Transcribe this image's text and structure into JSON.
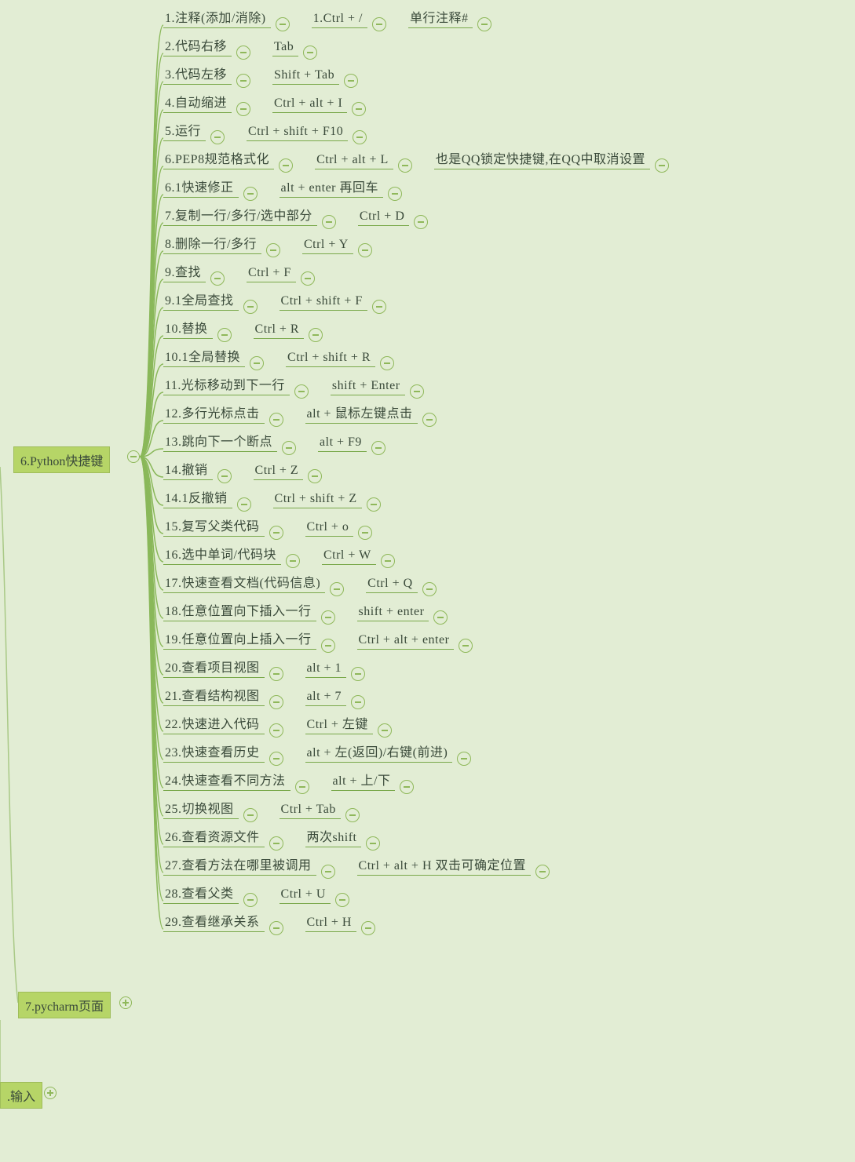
{
  "root": {
    "label": "6.Python快捷键"
  },
  "aux1": {
    "label": "7.pycharm页面"
  },
  "aux2": {
    "label": ".输入"
  },
  "rows": [
    {
      "segs": [
        "1.注释(添加/消除)",
        "1.Ctrl + /",
        "单行注释#"
      ]
    },
    {
      "segs": [
        "2.代码右移",
        "Tab"
      ]
    },
    {
      "segs": [
        "3.代码左移",
        "Shift + Tab"
      ]
    },
    {
      "segs": [
        "4.自动缩进",
        "Ctrl + alt + I"
      ]
    },
    {
      "segs": [
        "5.运行",
        "Ctrl + shift + F10"
      ]
    },
    {
      "segs": [
        "6.PEP8规范格式化",
        "Ctrl + alt + L",
        "也是QQ锁定快捷键,在QQ中取消设置"
      ]
    },
    {
      "segs": [
        "6.1快速修正",
        "alt + enter 再回车"
      ]
    },
    {
      "segs": [
        "7.复制一行/多行/选中部分",
        "Ctrl + D"
      ]
    },
    {
      "segs": [
        "8.删除一行/多行",
        "Ctrl + Y"
      ]
    },
    {
      "segs": [
        "9.查找",
        "Ctrl + F"
      ]
    },
    {
      "segs": [
        "9.1全局查找",
        "Ctrl + shift + F"
      ]
    },
    {
      "segs": [
        "10.替换",
        "Ctrl + R"
      ]
    },
    {
      "segs": [
        "10.1全局替换",
        "Ctrl + shift + R"
      ]
    },
    {
      "segs": [
        "11.光标移动到下一行",
        "shift + Enter"
      ]
    },
    {
      "segs": [
        "12.多行光标点击",
        "alt + 鼠标左键点击"
      ]
    },
    {
      "segs": [
        "13.跳向下一个断点",
        "alt + F9"
      ]
    },
    {
      "segs": [
        "14.撤销",
        "Ctrl + Z"
      ]
    },
    {
      "segs": [
        "14.1反撤销",
        "Ctrl + shift + Z"
      ]
    },
    {
      "segs": [
        "15.复写父类代码",
        "Ctrl + o"
      ]
    },
    {
      "segs": [
        "16.选中单词/代码块",
        "Ctrl + W"
      ]
    },
    {
      "segs": [
        "17.快速查看文档(代码信息)",
        "Ctrl + Q"
      ]
    },
    {
      "segs": [
        "18.任意位置向下插入一行",
        "shift + enter"
      ]
    },
    {
      "segs": [
        "19.任意位置向上插入一行",
        "Ctrl + alt + enter"
      ]
    },
    {
      "segs": [
        "20.查看项目视图",
        "alt + 1"
      ]
    },
    {
      "segs": [
        "21.查看结构视图",
        "alt + 7"
      ]
    },
    {
      "segs": [
        "22.快速进入代码",
        "Ctrl + 左键"
      ]
    },
    {
      "segs": [
        "23.快速查看历史",
        "alt + 左(返回)/右键(前进)"
      ]
    },
    {
      "segs": [
        "24.快速查看不同方法",
        "alt + 上/下"
      ]
    },
    {
      "segs": [
        "25.切换视图",
        "Ctrl + Tab"
      ]
    },
    {
      "segs": [
        "26.查看资源文件",
        "两次shift"
      ]
    },
    {
      "segs": [
        "27.查看方法在哪里被调用",
        "Ctrl + alt + H 双击可确定位置"
      ]
    },
    {
      "segs": [
        "28.查看父类",
        "Ctrl + U"
      ]
    },
    {
      "segs": [
        "29.查看继承关系",
        "Ctrl + H"
      ]
    }
  ]
}
